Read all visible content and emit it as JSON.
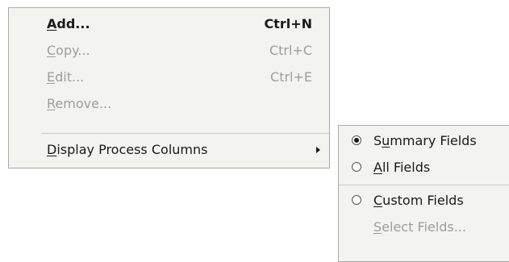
{
  "main_menu": {
    "items": [
      {
        "pre": "",
        "mnemonic": "A",
        "post": "dd...",
        "shortcut": "Ctrl+N",
        "enabled": true,
        "bold": true
      },
      {
        "pre": "",
        "mnemonic": "C",
        "post": "opy...",
        "shortcut": "Ctrl+C",
        "enabled": false
      },
      {
        "pre": "",
        "mnemonic": "E",
        "post": "dit...",
        "shortcut": "Ctrl+E",
        "enabled": false
      },
      {
        "pre": "",
        "mnemonic": "R",
        "post": "emove...",
        "shortcut": "",
        "enabled": false
      },
      {
        "pre": "",
        "mnemonic": "D",
        "post": "isplay Process Columns",
        "shortcut": "",
        "enabled": true,
        "submenu": true
      }
    ]
  },
  "sub_menu": {
    "items": [
      {
        "pre": "S",
        "mnemonic": "u",
        "post": "mmary Fields",
        "radio": true,
        "checked": true,
        "enabled": true
      },
      {
        "pre": "",
        "mnemonic": "A",
        "post": "ll Fields",
        "radio": true,
        "checked": false,
        "enabled": true
      },
      {
        "pre": "",
        "mnemonic": "C",
        "post": "ustom Fields",
        "radio": true,
        "checked": false,
        "enabled": true
      },
      {
        "pre": "",
        "mnemonic": "S",
        "post": "elect Fields...",
        "radio": false,
        "enabled": false
      }
    ]
  },
  "colors": {
    "menu_bg": "#f3f3ef",
    "border": "#a8a8a4",
    "text": "#1a1a1a",
    "disabled_text": "#9d9d9b"
  },
  "icons": [
    "radio-checked-icon",
    "radio-unchecked-icon",
    "submenu-arrow-icon"
  ]
}
